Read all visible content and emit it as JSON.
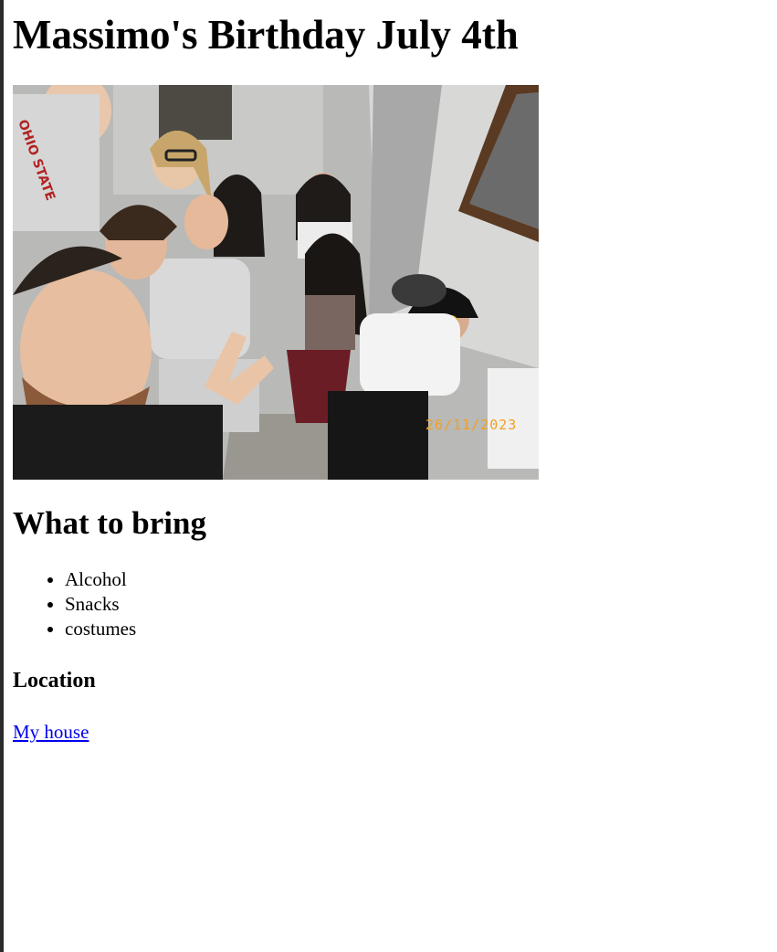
{
  "page": {
    "title": "Massimo's Birthday July 4th"
  },
  "photo": {
    "date_stamp": "26/11/2023",
    "shirt_text": "OHIO STATE"
  },
  "bring": {
    "heading": "What to bring",
    "items": [
      "Alcohol",
      "Snacks",
      "costumes"
    ]
  },
  "location": {
    "heading": "Location",
    "link_text": "My house"
  },
  "colors": {
    "link": "#0000ee",
    "date_stamp": "#f2a020",
    "left_edge": "#2b2b2b"
  }
}
